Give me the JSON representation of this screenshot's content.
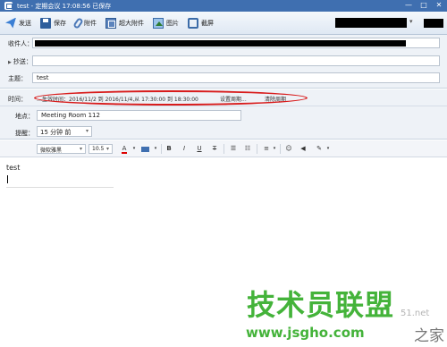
{
  "window": {
    "title": "test - 定期会议   17:08:56 已保存",
    "controls": [
      "—",
      "□",
      "✕"
    ]
  },
  "toolbar": {
    "send": "发送",
    "save": "保存",
    "attach": "附件",
    "big_attach": "超大附件",
    "picture": "图片",
    "screenshot": "截屏",
    "caret": "▾"
  },
  "headers": {
    "to_label": "收件人：",
    "cc_arrow": "▶",
    "cc_label": "抄送：",
    "subject_label": "主题：",
    "subject_value": "test"
  },
  "meeting": {
    "time_label": "时间：",
    "time_text": "…生效时间：2016/11/2 到 2016/11/4,从 17:30:00 到 18:30:00",
    "set_recurrence": "设置周期...",
    "clear_recurrence": "清除周期",
    "location_label": "地点：",
    "location_value": "Meeting Room 112",
    "reminder_label": "提醒：",
    "reminder_value": "15 分钟 前",
    "caret": "▾"
  },
  "format": {
    "font_family": "微软雅黑",
    "font_size": "10.5",
    "caret": "▾",
    "font_color_icon": "A",
    "bold": "B",
    "italic": "I",
    "underline": "U",
    "strike": "T",
    "ul_icon": "☰",
    "ol_icon": "☷",
    "align_icon": "≡",
    "emoji_icon": "☺",
    "sound_icon": "◀",
    "tool_icon": "✎"
  },
  "body": {
    "text": "test"
  },
  "watermark": {
    "main": "技术员联盟",
    "url": "www.jsgho.com",
    "side_a": "51.net",
    "side_b": "之家"
  },
  "colors": {
    "titlebar": "#3f6fb0",
    "highlight_ellipse": "#d81b1b",
    "watermark": "#44b33a"
  }
}
